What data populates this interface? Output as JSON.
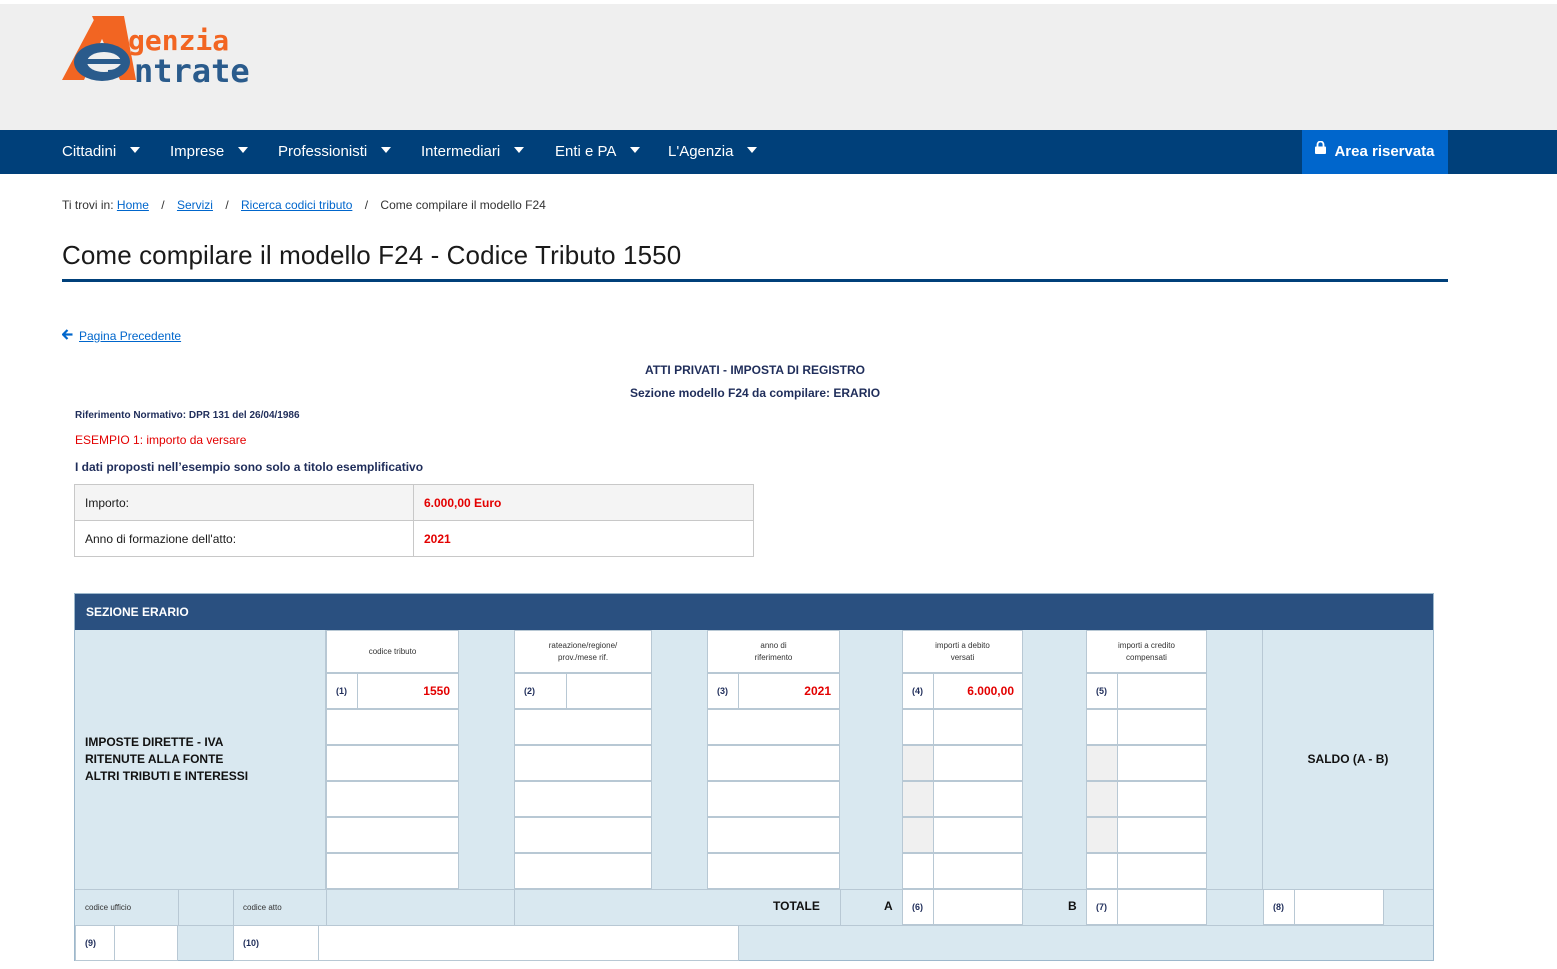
{
  "brand": {
    "logo_line1": "genzia",
    "logo_line2": "ntrate",
    "accent": "#f26522",
    "primary": "#00407a"
  },
  "nav": {
    "items": [
      {
        "label": "Cittadini"
      },
      {
        "label": "Imprese"
      },
      {
        "label": "Professionisti"
      },
      {
        "label": "Intermediari"
      },
      {
        "label": "Enti e PA"
      },
      {
        "label": "L'Agenzia"
      }
    ],
    "area_riservata": "Area riservata"
  },
  "breadcrumb": {
    "prefix": "Ti trovi in:",
    "home": "Home",
    "servizi": "Servizi",
    "ricerca": "Ricerca codici tributo",
    "current": "Come compilare il modello F24"
  },
  "page": {
    "title": "Come compilare il modello F24 - Codice Tributo 1550",
    "back": "Pagina Precedente"
  },
  "content": {
    "heading1": "ATTI PRIVATI - IMPOSTA DI REGISTRO",
    "heading2": "Sezione modello F24 da compilare: ERARIO",
    "riferimento": "Riferimento Normativo: DPR  131 del 26/04/1986",
    "esempio": "ESEMPIO 1: importo da versare",
    "disclaimer": "I dati proposti nell’esempio sono solo a titolo esemplificativo",
    "importo_label": "Importo:",
    "importo_value": "6.000,00 Euro",
    "anno_label": "Anno di formazione dell'atto:",
    "anno_value": "2021"
  },
  "f24": {
    "section_title": "SEZIONE ERARIO",
    "side_line1": "IMPOSTE DIRETTE - IVA",
    "side_line2": "RITENUTE ALLA FONTE",
    "side_line3": "ALTRI TRIBUTI E INTERESSI",
    "col_codice_tributo": "codice tributo",
    "col_rateazione_1": "rateazione/regione/",
    "col_rateazione_2": "prov./mese rif.",
    "col_anno_1": "anno di",
    "col_anno_2": "riferimento",
    "col_debito_1": "importi a debito",
    "col_debito_2": "versati",
    "col_credito_1": "importi a credito",
    "col_credito_2": "compensati",
    "n1": "(1)",
    "n2": "(2)",
    "n3": "(3)",
    "n4": "(4)",
    "n5": "(5)",
    "n6": "(6)",
    "n7": "(7)",
    "n8": "(8)",
    "n9": "(9)",
    "n10": "(10)",
    "codice_tributo": "1550",
    "anno": "2021",
    "importo_debito": "6.000,00",
    "saldo": "SALDO (A - B)",
    "codice_ufficio": "codice ufficio",
    "codice_atto": "codice atto",
    "totale": "TOTALE",
    "a": "A",
    "b": "B"
  }
}
